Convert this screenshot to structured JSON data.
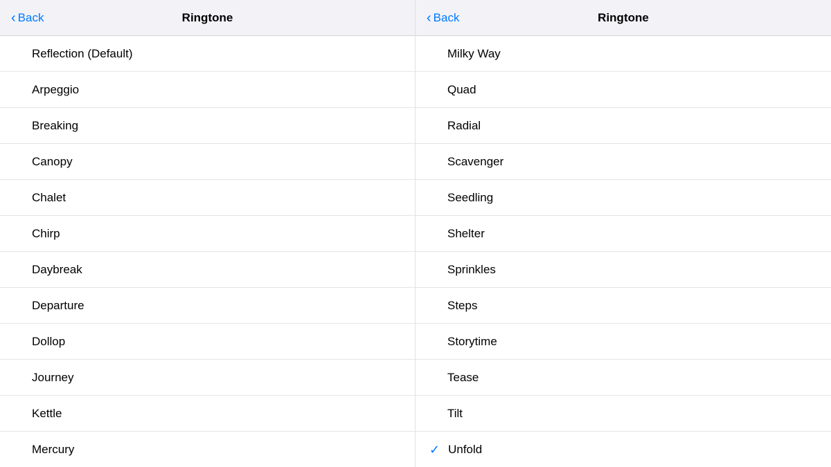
{
  "panels": [
    {
      "id": "left",
      "nav": {
        "back_label": "Back",
        "title": "Ringtone"
      },
      "items": [
        {
          "label": "Reflection (Default)",
          "checked": false
        },
        {
          "label": "Arpeggio",
          "checked": false
        },
        {
          "label": "Breaking",
          "checked": false
        },
        {
          "label": "Canopy",
          "checked": false
        },
        {
          "label": "Chalet",
          "checked": false
        },
        {
          "label": "Chirp",
          "checked": false
        },
        {
          "label": "Daybreak",
          "checked": false
        },
        {
          "label": "Departure",
          "checked": false
        },
        {
          "label": "Dollop",
          "checked": false
        },
        {
          "label": "Journey",
          "checked": false
        },
        {
          "label": "Kettle",
          "checked": false
        },
        {
          "label": "Mercury",
          "checked": false
        }
      ]
    },
    {
      "id": "right",
      "nav": {
        "back_label": "Back",
        "title": "Ringtone"
      },
      "items": [
        {
          "label": "Milky Way",
          "checked": false
        },
        {
          "label": "Quad",
          "checked": false
        },
        {
          "label": "Radial",
          "checked": false
        },
        {
          "label": "Scavenger",
          "checked": false
        },
        {
          "label": "Seedling",
          "checked": false
        },
        {
          "label": "Shelter",
          "checked": false
        },
        {
          "label": "Sprinkles",
          "checked": false
        },
        {
          "label": "Steps",
          "checked": false
        },
        {
          "label": "Storytime",
          "checked": false
        },
        {
          "label": "Tease",
          "checked": false
        },
        {
          "label": "Tilt",
          "checked": false
        },
        {
          "label": "Unfold",
          "checked": true
        }
      ]
    }
  ],
  "colors": {
    "blue": "#007aff"
  }
}
